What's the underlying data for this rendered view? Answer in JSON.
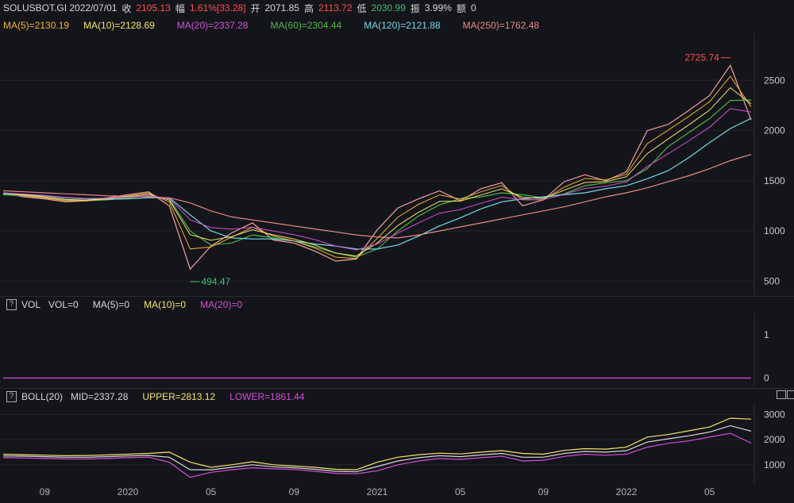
{
  "header": {
    "symbol_date": "SOLUSBOT.GI 2022/07/01",
    "close_label": "收",
    "close": "2105.13",
    "change_label": "幅",
    "change": "1.61%[33.28]",
    "open_label": "开",
    "open": "2071.85",
    "high_label": "高",
    "high": "2113.72",
    "low_label": "低",
    "low": "2030.99",
    "amp_label": "振",
    "amp": "3.99%",
    "amount_label": "额",
    "amount": "0"
  },
  "ma_legend": [
    {
      "text": "MA(5)=2130.19",
      "color": "#f2b233"
    },
    {
      "text": "MA(10)=2128.69",
      "color": "#f3e36b"
    },
    {
      "text": "MA(20)=2337.28",
      "color": "#d24fd6"
    },
    {
      "text": "MA(60)=2304.44",
      "color": "#4fb548"
    },
    {
      "text": "MA(120)=2121.88",
      "color": "#6fd8e6"
    },
    {
      "text": "MA(250)=1762.48",
      "color": "#e68a84"
    }
  ],
  "vol_header": {
    "title": "VOL",
    "items": [
      {
        "text": "VOL=0",
        "color": "#d8d8d8"
      },
      {
        "text": "MA(5)=0",
        "color": "#d8d8d8"
      },
      {
        "text": "MA(10)=0",
        "color": "#f3e36b"
      },
      {
        "text": "MA(20)=0",
        "color": "#d24fd6"
      }
    ]
  },
  "boll_header": {
    "title": "BOLL(20)",
    "items": [
      {
        "text": "MID=2337.28",
        "color": "#d8d8d8"
      },
      {
        "text": "UPPER=2813.12",
        "color": "#f3e36b"
      },
      {
        "text": "LOWER=1861.44",
        "color": "#d24fd6"
      }
    ]
  },
  "chart_data": [
    {
      "type": "line",
      "title": "",
      "y_ticks": [
        500,
        1000,
        1500,
        2000,
        2500
      ],
      "ylim": [
        400,
        2850
      ],
      "annotations": [
        {
          "text": "2725.74",
          "label": "high",
          "color": "#ff4d4f"
        },
        {
          "text": "494.47",
          "label": "low",
          "color": "#3fbf6f"
        }
      ],
      "x": [
        "2019-07",
        "2019-08",
        "2019-09",
        "2019-10",
        "2019-11",
        "2019-12",
        "2020-01",
        "2020-02",
        "2020-03",
        "2020-04",
        "2020-05",
        "2020-06",
        "2020-07",
        "2020-08",
        "2020-09",
        "2020-10",
        "2020-11",
        "2020-12",
        "2021-01",
        "2021-02",
        "2021-03",
        "2021-04",
        "2021-05",
        "2021-06",
        "2021-07",
        "2021-08",
        "2021-09",
        "2021-10",
        "2021-11",
        "2021-12",
        "2022-01",
        "2022-02",
        "2022-03",
        "2022-04",
        "2022-05",
        "2022-06",
        "2022-07"
      ],
      "series": [
        {
          "role": "price",
          "color": "#f3a0a0",
          "values": [
            1380,
            1340,
            1320,
            1290,
            1300,
            1330,
            1360,
            1390,
            1250,
            620,
            850,
            980,
            1080,
            910,
            880,
            800,
            700,
            720,
            1010,
            1230,
            1320,
            1400,
            1300,
            1420,
            1480,
            1250,
            1310,
            1490,
            1560,
            1500,
            1590,
            2000,
            2060,
            2200,
            2350,
            2650,
            2105
          ]
        },
        {
          "role": "MA(60)",
          "color": "#4fb548",
          "values": [
            1360,
            1350,
            1330,
            1310,
            1300,
            1310,
            1330,
            1350,
            1320,
            1000,
            860,
            880,
            960,
            930,
            900,
            840,
            780,
            740,
            820,
            1000,
            1150,
            1260,
            1320,
            1340,
            1380,
            1360,
            1330,
            1370,
            1450,
            1480,
            1500,
            1620,
            1840,
            1980,
            2120,
            2300,
            2304
          ]
        },
        {
          "role": "MA(120)",
          "color": "#6fd8e6",
          "values": [
            1370,
            1360,
            1350,
            1330,
            1320,
            1315,
            1320,
            1330,
            1330,
            1160,
            1000,
            930,
            920,
            920,
            900,
            870,
            850,
            820,
            820,
            860,
            950,
            1050,
            1130,
            1220,
            1290,
            1320,
            1340,
            1360,
            1380,
            1420,
            1450,
            1520,
            1600,
            1730,
            1880,
            2020,
            2121
          ]
        },
        {
          "role": "MA(250)",
          "color": "#e68a84",
          "values": [
            1400,
            1390,
            1380,
            1370,
            1360,
            1350,
            1345,
            1340,
            1330,
            1280,
            1200,
            1140,
            1110,
            1080,
            1050,
            1020,
            990,
            960,
            940,
            930,
            960,
            1000,
            1040,
            1080,
            1120,
            1160,
            1200,
            1240,
            1290,
            1340,
            1380,
            1430,
            1490,
            1550,
            1620,
            1700,
            1762
          ]
        }
      ]
    },
    {
      "type": "line",
      "title": "",
      "y_ticks": [
        0,
        1
      ],
      "ylim": [
        -0.1,
        1.4
      ],
      "series": [
        {
          "role": "VOL",
          "color": "#d24fd6",
          "values": [
            0,
            0
          ]
        }
      ]
    },
    {
      "type": "line",
      "title": "",
      "y_ticks": [
        1000,
        2000,
        3000
      ],
      "ylim": [
        300,
        3200
      ],
      "x_ticks": [
        "09",
        "2020",
        "05",
        "09",
        "2021",
        "05",
        "09",
        "2022",
        "05"
      ],
      "x_tick_months": [
        "2019-09",
        "2020-01",
        "2020-05",
        "2020-09",
        "2021-01",
        "2021-05",
        "2021-09",
        "2022-01",
        "2022-05"
      ],
      "series": [
        {
          "role": "MID",
          "color": "#d8d8d8",
          "values": [
            1350,
            1340,
            1320,
            1300,
            1300,
            1320,
            1350,
            1370,
            1300,
            800,
            800,
            900,
            1000,
            920,
            880,
            820,
            740,
            720,
            930,
            1150,
            1280,
            1360,
            1320,
            1390,
            1450,
            1300,
            1300,
            1450,
            1530,
            1500,
            1560,
            1900,
            2030,
            2150,
            2300,
            2550,
            2337
          ]
        },
        {
          "role": "UPPER",
          "color": "#f3e36b",
          "values": [
            1420,
            1400,
            1380,
            1360,
            1370,
            1390,
            1420,
            1450,
            1500,
            1100,
            900,
            1000,
            1120,
            1000,
            950,
            900,
            820,
            800,
            1100,
            1300,
            1400,
            1460,
            1430,
            1500,
            1560,
            1450,
            1420,
            1570,
            1640,
            1620,
            1700,
            2100,
            2200,
            2350,
            2500,
            2850,
            2813
          ]
        },
        {
          "role": "LOWER",
          "color": "#d24fd6",
          "values": [
            1280,
            1270,
            1250,
            1230,
            1230,
            1250,
            1280,
            1300,
            1100,
            500,
            700,
            800,
            880,
            840,
            810,
            740,
            660,
            640,
            760,
            1000,
            1150,
            1250,
            1210,
            1280,
            1340,
            1150,
            1180,
            1330,
            1420,
            1380,
            1420,
            1700,
            1850,
            1950,
            2100,
            2250,
            1861
          ]
        }
      ]
    }
  ]
}
